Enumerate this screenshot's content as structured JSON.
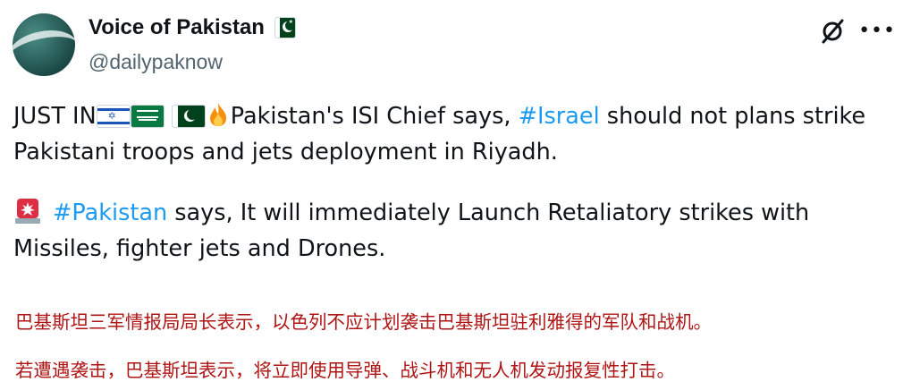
{
  "author": {
    "display_name": "Voice of Pakistan",
    "handle": "@dailypaknow",
    "badge_icon": "pakistan-flag-icon"
  },
  "header_icons": [
    "grok-icon",
    "more-icon"
  ],
  "more_label": "•••",
  "tweet": {
    "p1": {
      "lead": "JUST IN",
      "emojis": [
        "israel-flag-icon",
        "saudi-flag-icon",
        "pakistan-flag-icon",
        "fire-icon"
      ],
      "text_before": "Pakistan's ISI Chief says, ",
      "hashtag": "#Israel",
      "text_after": " should not plans strike Pakistani troops and jets deployment in Riyadh."
    },
    "p2": {
      "emoji": "siren-icon",
      "hashtag": "#Pakistan",
      "text_after": " says, It will immediately Launch Retaliatory strikes with Missiles, fighter jets and Drones."
    },
    "chinese_1": "巴基斯坦三军情报局局长表示，以色列不应计划袭击巴基斯坦驻利雅得的军队和战机。",
    "chinese_2": "若遭遇袭击，巴基斯坦表示，将立即使用导弹、战斗机和无人机发动报复性打击。"
  },
  "colors": {
    "text": "#0f1419",
    "secondary": "#536471",
    "hashtag": "#1d9bf0",
    "translation": "#b01515"
  }
}
